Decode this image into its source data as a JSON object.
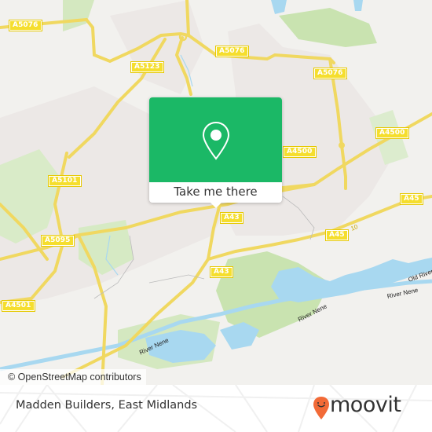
{
  "map": {
    "road_labels": [
      {
        "id": "a5076-w",
        "text": "A5076"
      },
      {
        "id": "a5076-n",
        "text": "A5076"
      },
      {
        "id": "a5076-e",
        "text": "A5076"
      },
      {
        "id": "a5123",
        "text": "A5123"
      },
      {
        "id": "a4500-c",
        "text": "A4500"
      },
      {
        "id": "a4500-e",
        "text": "A4500"
      },
      {
        "id": "a5101",
        "text": "A5101"
      },
      {
        "id": "a5095",
        "text": "A5095"
      },
      {
        "id": "a4501",
        "text": "A4501"
      },
      {
        "id": "a43-n",
        "text": "A43"
      },
      {
        "id": "a43-s",
        "text": "A43"
      },
      {
        "id": "a45-e",
        "text": "A45"
      },
      {
        "id": "a45-c",
        "text": "A45"
      }
    ],
    "water_labels": [
      {
        "id": "river-nene-1",
        "text": "River Nene"
      },
      {
        "id": "river-nene-2",
        "text": "River Nene"
      },
      {
        "id": "river-nene-3",
        "text": "River Nene"
      },
      {
        "id": "old-river",
        "text": "Old River"
      }
    ],
    "junction_label": "10",
    "attribution": "© OpenStreetMap contributors"
  },
  "popup": {
    "icon": "map-pin-icon",
    "button_label": "Take me there",
    "color": "#1bb866"
  },
  "footer": {
    "place_name": "Madden Builders, East Midlands",
    "brand": "moovit",
    "brand_color": "#f26a37"
  }
}
